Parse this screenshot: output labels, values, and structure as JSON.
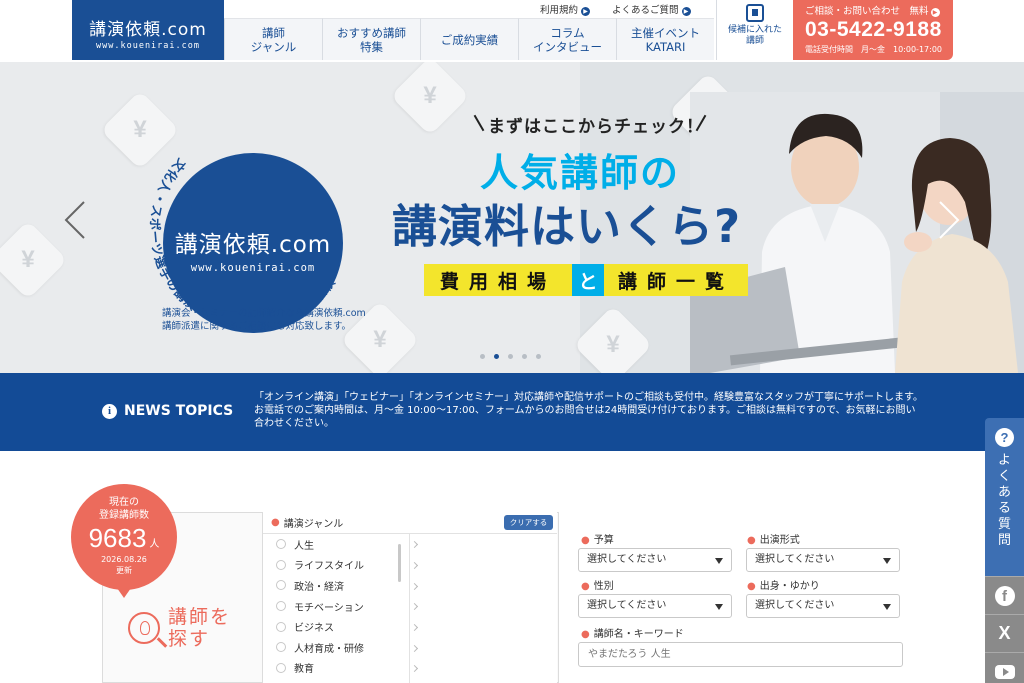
{
  "header": {
    "logo_main": "講演依頼.com",
    "logo_sub": "www.kouenirai.com",
    "sublinks": [
      "利用規約",
      "よくあるご質問"
    ],
    "nav": [
      "講師\nジャンル",
      "おすすめ講師\n特集",
      "ご成約実績",
      "コラム\nインタビュー",
      "主催イベント\nKATARI"
    ],
    "favorites": "候補に入れた講師",
    "contact_label": "ご相談・お問い合わせ　無料",
    "phone": "03-5422-9188",
    "hours": "電話受付時間　月〜金　10:00-17:00"
  },
  "hero": {
    "emblem_main": "講演依頼.com",
    "emblem_sub": "www.kouenirai.com",
    "emblem_ring": "文化人・スポーツ選手の講演・研修・イベント出演依頼",
    "caption_1": "講演会・セミナーの講師紹介なら講演依頼.com",
    "caption_2": "講師派遣に関するご相談にも対応致します。",
    "check": "まずはここからチェック！",
    "headline_1": "人気講師の",
    "headline_2": "講演料はいくら?",
    "tag_1": "費用相場",
    "tag_2": "と",
    "tag_3": "講師一覧",
    "yen": "¥",
    "active_slide": 2,
    "slide_count": 5
  },
  "news": {
    "title": "NEWS TOPICS",
    "text": "「オンライン講演」「ウェビナー」「オンラインセミナー」対応講師や配信サポートのご相談も受付中。経験豊富なスタッフが丁寧にサポートします。お電話でのご案内時間は、月〜金 10:00〜17:00、フォームからのお問合せは24時間受け付けております。ご相談は無料ですので、お気軽にお問い合わせください。"
  },
  "search": {
    "count_label": "現在の\n登録講師数",
    "count": "9683",
    "count_unit": "人",
    "date": "2026.08.26",
    "updated": "更新",
    "find_label": "講師を\n探す",
    "genre_label": "講演ジャンル",
    "clear_label": "クリアする",
    "genres": [
      "人生",
      "ライフスタイル",
      "政治・経済",
      "モチベーション",
      "ビジネス",
      "人材育成・研修",
      "教育"
    ],
    "budget_label": "予算",
    "format_label": "出演形式",
    "gender_label": "性別",
    "origin_label": "出身・ゆかり",
    "select_placeholder": "選択してください",
    "keyword_label": "講師名・キーワード",
    "keyword_placeholder": "やまだたろう 人生"
  },
  "rail": {
    "faq": "よくある質問",
    "x_glyph": "X"
  },
  "colors": {
    "brand_blue": "#1a4f95",
    "accent_coral": "#ec6b5c",
    "accent_cyan": "#00aee8",
    "accent_yellow": "#f3e52c"
  }
}
